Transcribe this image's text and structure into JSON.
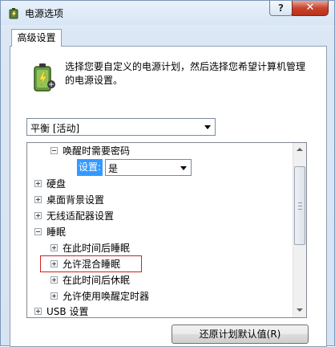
{
  "window": {
    "title": "电源选项",
    "help_label": "?",
    "close_label": "✕"
  },
  "tab": {
    "label": "高级设置"
  },
  "description": "选择您要自定义的电源计划，然后选择您希望计算机管理的电源设置。",
  "plan_select": {
    "value": "平衡 [活动]"
  },
  "tree": {
    "rows": [
      {
        "label": "唤醒时需要密码",
        "expander": "minus"
      },
      {
        "label": "硬盘",
        "expander": "plus"
      },
      {
        "label": "桌面背景设置",
        "expander": "plus"
      },
      {
        "label": "无线适配器设置",
        "expander": "plus"
      },
      {
        "label": "睡眠",
        "expander": "minus"
      },
      {
        "label": "在此时间后睡眠",
        "expander": "plus"
      },
      {
        "label": "允许混合睡眠",
        "expander": "plus"
      },
      {
        "label": "在此时间后休眠",
        "expander": "plus"
      },
      {
        "label": "允许使用唤醒定时器",
        "expander": "plus"
      },
      {
        "label": "USB 设置",
        "expander": "plus"
      }
    ],
    "setting": {
      "label": "设置:",
      "value": "是"
    }
  },
  "restore_button": {
    "label": "还原计划默认值(R)"
  },
  "colors": {
    "selection": "#3399ff",
    "highlight_box": "#cc2222",
    "close_button": "#c9432d"
  }
}
